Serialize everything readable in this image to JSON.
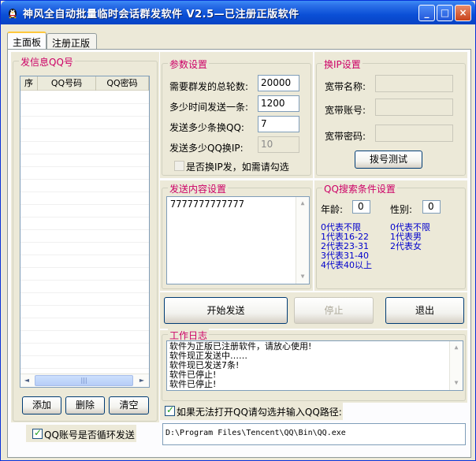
{
  "window": {
    "title": "神风全自动批量临时会话群发软件 V2.5—已注册正版软件",
    "title_icon": "penguin-icon",
    "minimize": "_",
    "maximize": "□",
    "close": "×"
  },
  "tabs": [
    {
      "label": "主面板",
      "active": true
    },
    {
      "label": "注册正版",
      "active": false
    }
  ],
  "qq_list": {
    "title": "发信息QQ号",
    "columns": [
      "序",
      "QQ号码",
      "QQ密码"
    ],
    "rows": [],
    "scroll_thumb": "|||",
    "scroll_left": "◄",
    "scroll_right": "►",
    "buttons": {
      "add": "添加",
      "delete": "删除",
      "clear": "清空"
    },
    "loop_checkbox": {
      "label": "QQ账号是否循环发送",
      "checked": true
    }
  },
  "params": {
    "title": "参数设置",
    "total_rounds_label": "需要群发的总轮数:",
    "total_rounds_value": "20000",
    "interval_label": "多少时间发送一条:",
    "interval_value": "1200",
    "switch_qq_label": "发送多少条换QQ:",
    "switch_qq_value": "7",
    "switch_ip_label": "发送多少QQ换IP:",
    "switch_ip_value": "10",
    "switch_ip_checkbox": {
      "label": "是否换IP发，如需请勾选",
      "checked": false
    }
  },
  "ip": {
    "title": "换IP设置",
    "name_label": "宽带名称:",
    "name_value": "",
    "account_label": "宽带账号:",
    "account_value": "",
    "password_label": "宽带密码:",
    "password_value": "",
    "dial_button": "拨号测试"
  },
  "content": {
    "title": "发送内容设置",
    "text": "7777777777777",
    "scroll_up": "▲",
    "scroll_down": "▼"
  },
  "search": {
    "title": "QQ搜索条件设置",
    "age_label": "年龄:",
    "age_value": "0",
    "gender_label": "性别:",
    "gender_value": "0",
    "age_legend": [
      "0代表不限",
      "1代表16-22",
      "2代表23-31",
      "3代表31-40",
      "4代表40以上"
    ],
    "gender_legend": [
      "0代表不限",
      "1代表男",
      "2代表女"
    ]
  },
  "actions": {
    "start": "开始发送",
    "stop": "停止",
    "exit": "退出"
  },
  "log": {
    "title": "工作日志",
    "lines": [
      "软件为正版已注册软件，请放心使用!",
      "软件现正发送中……",
      "软件现已发送7条!",
      "软件已停止!",
      "软件已停止!"
    ],
    "scroll_up": "▲",
    "scroll_down": "▼"
  },
  "qq_path": {
    "checkbox": {
      "label": "如果无法打开QQ请勾选并输入QQ路径:",
      "checked": true
    },
    "value": "D:\\Program Files\\Tencent\\QQ\\Bin\\QQ.exe"
  },
  "colors": {
    "group_title": "#cc0066",
    "legend_text": "#0000cc",
    "titlebar": "#0a4fd6",
    "checkmark": "#21a121"
  }
}
